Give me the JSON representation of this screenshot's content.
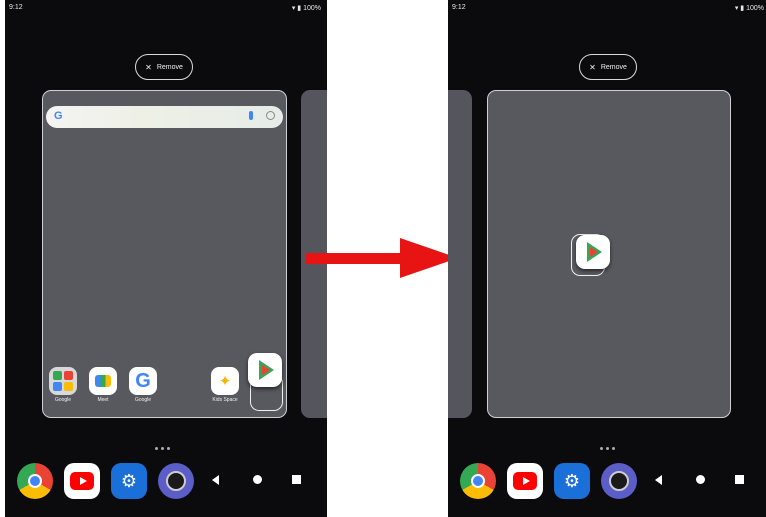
{
  "left_screen": {
    "status": {
      "time": "9:12",
      "battery": "▾ ▮ 100%"
    },
    "remove_label": "Remove",
    "apps": [
      {
        "label": "Google",
        "icon": "folder-icon"
      },
      {
        "label": "Meet",
        "icon": "meet-icon"
      },
      {
        "label": "Google",
        "icon": "google-icon"
      },
      {
        "label": "Kids Space",
        "icon": "kids-space-icon"
      }
    ],
    "dragged_app_icon": "play-store-icon",
    "search_logo": "G"
  },
  "right_screen": {
    "status": {
      "time": "9:12",
      "battery": "▾ ▮ 100%"
    },
    "remove_label": "Remove",
    "dropped_app_icon": "play-store-icon"
  },
  "dock": [
    {
      "icon": "chrome-icon"
    },
    {
      "icon": "youtube-icon"
    },
    {
      "icon": "settings-icon",
      "glyph": "⚙"
    },
    {
      "icon": "camera-icon"
    }
  ],
  "colors": {
    "arrow": "#e81414",
    "screen_bg": "#0b0b0d",
    "page_bg": "#58585f"
  }
}
